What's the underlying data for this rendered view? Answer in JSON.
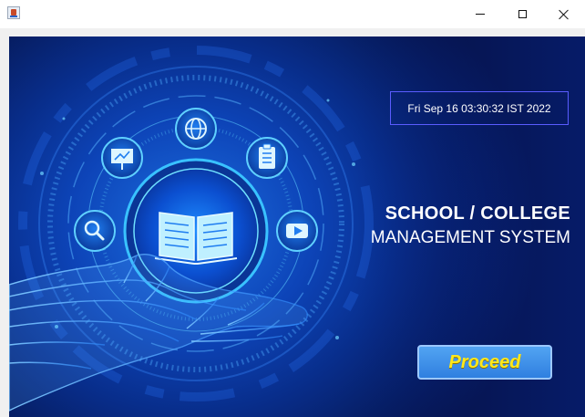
{
  "window": {
    "icons": {
      "app": "java-app-icon",
      "minimize": "minimize-icon",
      "maximize": "maximize-icon",
      "close": "close-icon"
    }
  },
  "main": {
    "datetime": "Fri Sep 16 03:30:32 IST 2022",
    "heading_line1": "SCHOOL / COLLEGE",
    "heading_line2": "MANAGEMENT SYSTEM",
    "proceed_label": "Proceed"
  },
  "illustration": {
    "center_icon": "open-book-icon",
    "orbit_icons": [
      "search-icon",
      "presentation-icon",
      "globe-icon",
      "clipboard-icon",
      "video-play-icon"
    ],
    "hand": "digital-hand-icon"
  },
  "colors": {
    "background_dark": "#061a5a",
    "background_glow": "#1c6fe0",
    "accent_cyan": "#5fd0ff",
    "button_fill": "#3b8ae8",
    "button_text": "#ffe81a",
    "datetime_border": "#5a5cff"
  }
}
